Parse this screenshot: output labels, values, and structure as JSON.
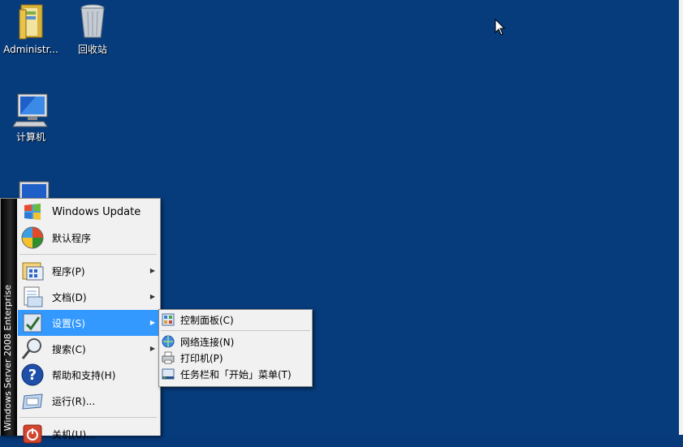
{
  "desktop": {
    "icons": [
      {
        "label": "Administr..."
      },
      {
        "label": "回收站"
      },
      {
        "label": "计算机"
      }
    ]
  },
  "start_menu": {
    "banner": "Windows Server 2008 Enterprise",
    "items": [
      {
        "label": "Windows Update"
      },
      {
        "label": "默认程序"
      },
      {
        "label": "程序(P)"
      },
      {
        "label": "文档(D)"
      },
      {
        "label": "设置(S)"
      },
      {
        "label": "搜索(C)"
      },
      {
        "label": "帮助和支持(H)"
      },
      {
        "label": "运行(R)..."
      },
      {
        "label": "关机(U)..."
      }
    ]
  },
  "settings_submenu": {
    "items": [
      {
        "label": "控制面板(C)"
      },
      {
        "label": "网络连接(N)"
      },
      {
        "label": "打印机(P)"
      },
      {
        "label": "任务栏和「开始」菜单(T)"
      }
    ]
  },
  "colors": {
    "desktop_background": "#063b7c",
    "menu_background": "#f1f1f1",
    "highlight": "#3399ff"
  },
  "icons": {
    "desktop": [
      "user-folder-icon",
      "recycle-bin-icon",
      "computer-icon"
    ],
    "menu": [
      "windows-update-icon",
      "default-programs-icon",
      "programs-icon",
      "documents-icon",
      "settings-icon",
      "search-icon",
      "help-icon",
      "run-icon",
      "shutdown-icon"
    ],
    "submenu": [
      "control-panel-icon",
      "network-connections-icon",
      "printer-icon",
      "taskbar-icon"
    ]
  }
}
